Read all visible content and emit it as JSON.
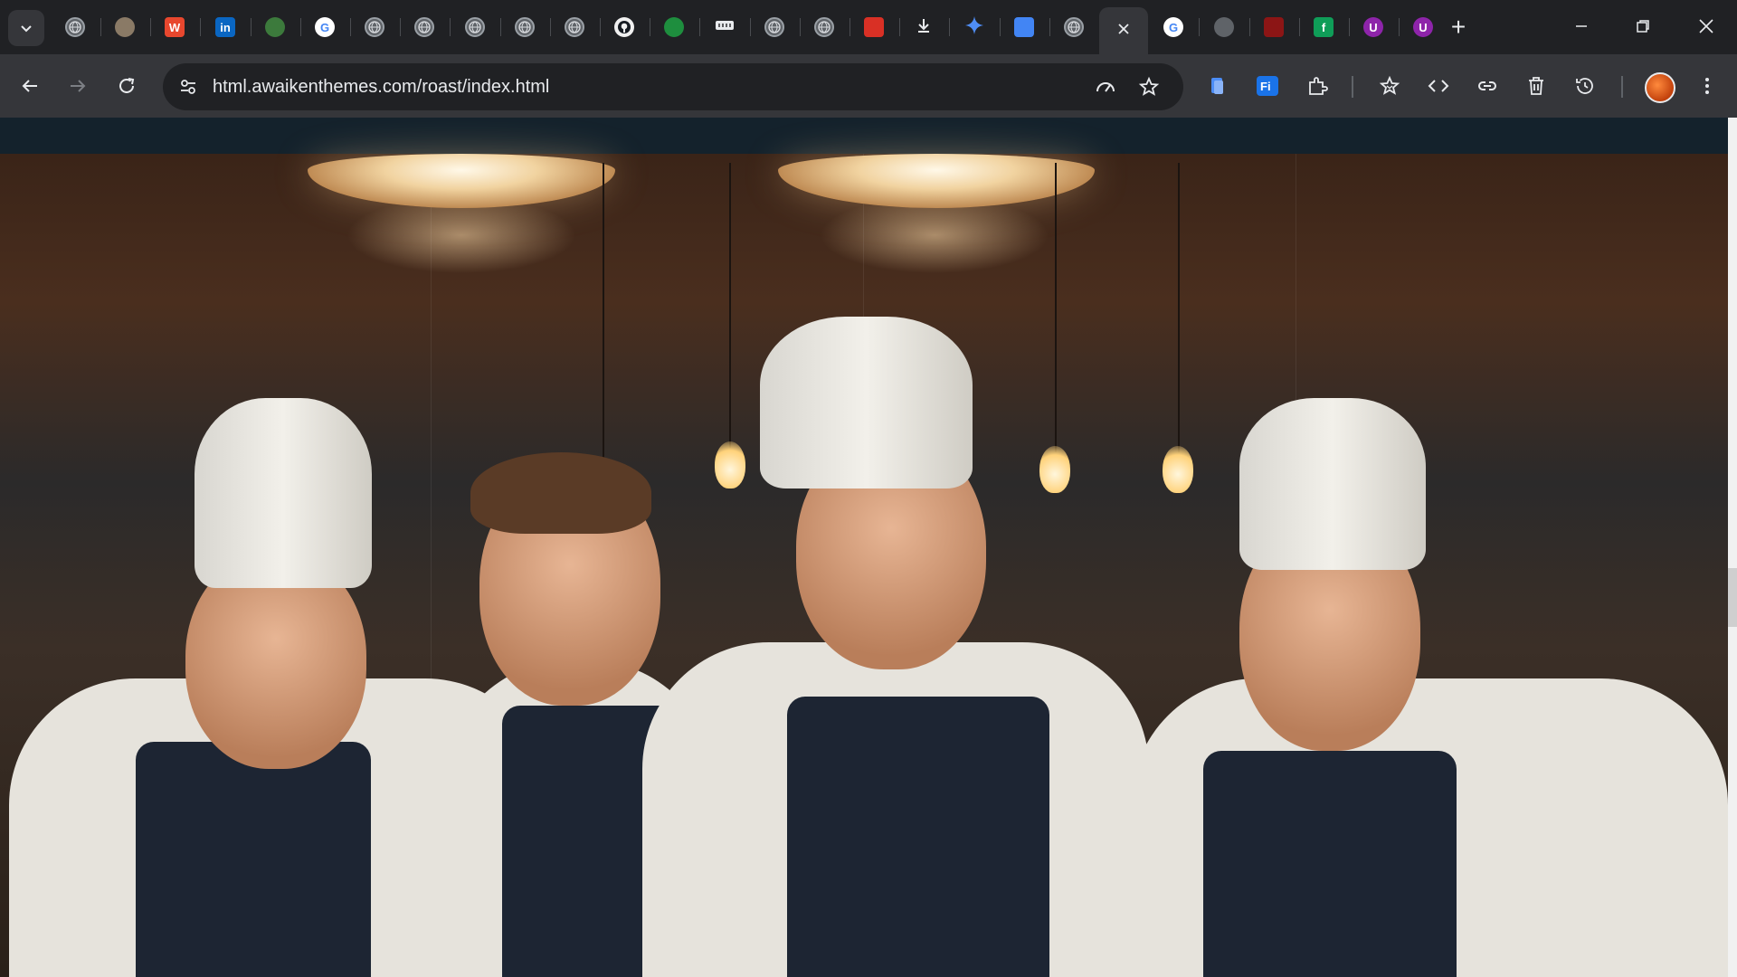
{
  "browser": {
    "url": "html.awaikenthemes.com/roast/index.html",
    "tabs": [
      {
        "icon": "globe-icon",
        "letter": ""
      },
      {
        "icon": "avatar-favicon-icon",
        "letter": ""
      },
      {
        "icon": "w-logo-icon",
        "letter": "W"
      },
      {
        "icon": "linkedin-icon",
        "letter": "in"
      },
      {
        "icon": "people-icon",
        "letter": ""
      },
      {
        "icon": "google-icon",
        "letter": "G"
      },
      {
        "icon": "globe-icon",
        "letter": ""
      },
      {
        "icon": "globe-icon",
        "letter": ""
      },
      {
        "icon": "globe-icon",
        "letter": ""
      },
      {
        "icon": "globe-icon",
        "letter": ""
      },
      {
        "icon": "globe-icon",
        "letter": ""
      },
      {
        "icon": "github-icon",
        "letter": ""
      },
      {
        "icon": "green-badge-icon",
        "letter": ""
      },
      {
        "icon": "ticket-icon",
        "letter": ""
      },
      {
        "icon": "globe-icon",
        "letter": ""
      },
      {
        "icon": "globe-icon",
        "letter": ""
      },
      {
        "icon": "cart-icon",
        "letter": ""
      },
      {
        "icon": "download-icon",
        "letter": ""
      },
      {
        "icon": "gemini-icon",
        "letter": ""
      },
      {
        "icon": "docs-icon",
        "letter": ""
      },
      {
        "icon": "globe-icon",
        "letter": ""
      },
      {
        "icon": "close-icon",
        "letter": "",
        "active": true
      },
      {
        "icon": "google-icon",
        "letter": "G"
      },
      {
        "icon": "gray-circle-icon",
        "letter": ""
      },
      {
        "icon": "stanford-icon",
        "letter": ""
      },
      {
        "icon": "f-logo-icon",
        "letter": "f"
      },
      {
        "icon": "purple-u-icon",
        "letter": "U"
      },
      {
        "icon": "purple-u-icon",
        "letter": "U"
      }
    ],
    "toolbar_icons": [
      "performance-icon",
      "bookmark-star-icon",
      "document-icon",
      "fi-extension-icon",
      "puzzle-icon",
      "reading-list-star-icon",
      "code-icon",
      "link-icon",
      "trash-icon",
      "history-icon",
      "profile-avatar",
      "kebab-menu-icon"
    ],
    "colors": {
      "frame": "#202124",
      "toolbar": "#35363a",
      "accent_active": "#35363a"
    }
  },
  "page": {
    "header_color": "#14222c",
    "hero_image": "chefs-team-photo"
  }
}
